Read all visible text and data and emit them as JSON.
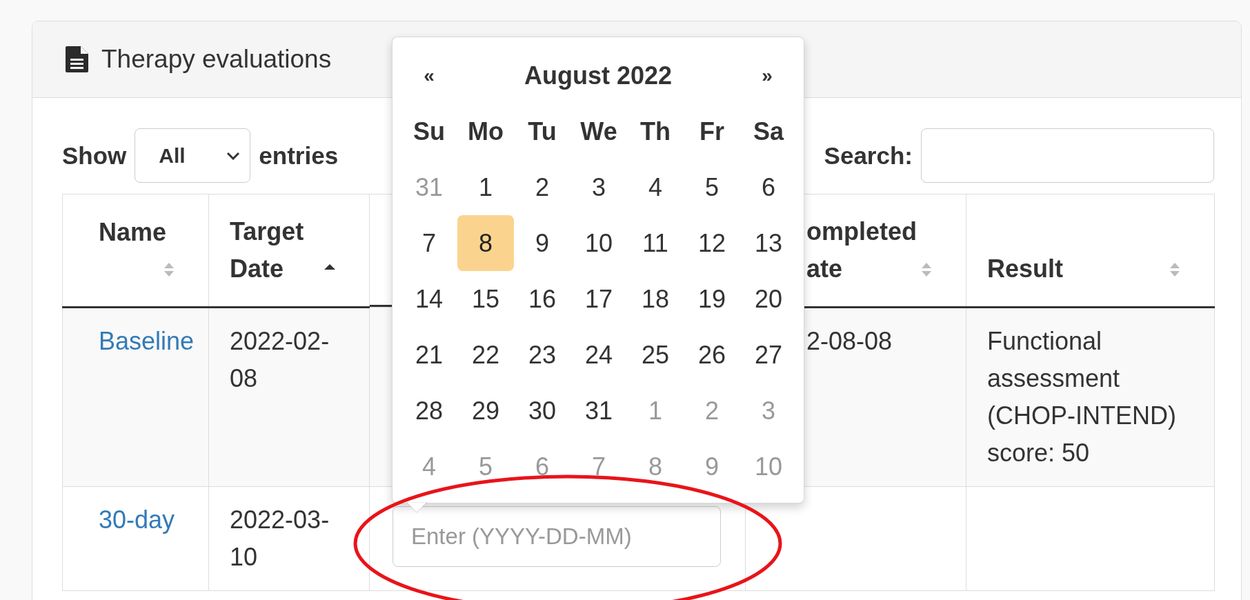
{
  "panel": {
    "title": "Therapy evaluations"
  },
  "length_control": {
    "label_before": "Show",
    "value": "All",
    "label_after": "entries"
  },
  "search": {
    "label": "Search:"
  },
  "table": {
    "columns": [
      {
        "kind": "sortable",
        "label": "Name",
        "sorted_ascending": false
      },
      {
        "kind": "sortable",
        "label": "Target Date",
        "sorted_ascending": true
      },
      {
        "kind": "covered"
      },
      {
        "kind": "sortable",
        "label": "ompleted ate",
        "sorted_ascending": false
      },
      {
        "kind": "sortable",
        "label": "Result",
        "sorted_ascending": false
      }
    ],
    "rows": [
      {
        "cells": [
          {
            "kind": "link",
            "text": "Baseline"
          },
          {
            "kind": "text",
            "text": "2022-02-08"
          },
          {
            "kind": "covered"
          },
          {
            "kind": "text",
            "text": "2-08-08"
          },
          {
            "kind": "text",
            "text": "Functional assessment (CHOP-INTEND) score: 50"
          }
        ]
      },
      {
        "cells": [
          {
            "kind": "link",
            "text": "30-day"
          },
          {
            "kind": "text",
            "text": "2022-03-10"
          },
          {
            "kind": "input",
            "placeholder": "Enter (YYYY-DD-MM)"
          },
          {
            "kind": "empty"
          },
          {
            "kind": "empty"
          }
        ]
      }
    ]
  },
  "datepicker": {
    "prev": "«",
    "title": "August 2022",
    "next": "»",
    "weekdays": [
      "Su",
      "Mo",
      "Tu",
      "We",
      "Th",
      "Fr",
      "Sa"
    ],
    "weeks": [
      [
        {
          "day": "31",
          "other_month": true,
          "selected": false
        },
        {
          "day": "1",
          "other_month": false,
          "selected": false
        },
        {
          "day": "2",
          "other_month": false,
          "selected": false
        },
        {
          "day": "3",
          "other_month": false,
          "selected": false
        },
        {
          "day": "4",
          "other_month": false,
          "selected": false
        },
        {
          "day": "5",
          "other_month": false,
          "selected": false
        },
        {
          "day": "6",
          "other_month": false,
          "selected": false
        }
      ],
      [
        {
          "day": "7",
          "other_month": false,
          "selected": false
        },
        {
          "day": "8",
          "other_month": false,
          "selected": true
        },
        {
          "day": "9",
          "other_month": false,
          "selected": false
        },
        {
          "day": "10",
          "other_month": false,
          "selected": false
        },
        {
          "day": "11",
          "other_month": false,
          "selected": false
        },
        {
          "day": "12",
          "other_month": false,
          "selected": false
        },
        {
          "day": "13",
          "other_month": false,
          "selected": false
        }
      ],
      [
        {
          "day": "14",
          "other_month": false,
          "selected": false
        },
        {
          "day": "15",
          "other_month": false,
          "selected": false
        },
        {
          "day": "16",
          "other_month": false,
          "selected": false
        },
        {
          "day": "17",
          "other_month": false,
          "selected": false
        },
        {
          "day": "18",
          "other_month": false,
          "selected": false
        },
        {
          "day": "19",
          "other_month": false,
          "selected": false
        },
        {
          "day": "20",
          "other_month": false,
          "selected": false
        }
      ],
      [
        {
          "day": "21",
          "other_month": false,
          "selected": false
        },
        {
          "day": "22",
          "other_month": false,
          "selected": false
        },
        {
          "day": "23",
          "other_month": false,
          "selected": false
        },
        {
          "day": "24",
          "other_month": false,
          "selected": false
        },
        {
          "day": "25",
          "other_month": false,
          "selected": false
        },
        {
          "day": "26",
          "other_month": false,
          "selected": false
        },
        {
          "day": "27",
          "other_month": false,
          "selected": false
        }
      ],
      [
        {
          "day": "28",
          "other_month": false,
          "selected": false
        },
        {
          "day": "29",
          "other_month": false,
          "selected": false
        },
        {
          "day": "30",
          "other_month": false,
          "selected": false
        },
        {
          "day": "31",
          "other_month": false,
          "selected": false
        },
        {
          "day": "1",
          "other_month": true,
          "selected": false
        },
        {
          "day": "2",
          "other_month": true,
          "selected": false
        },
        {
          "day": "3",
          "other_month": true,
          "selected": false
        }
      ],
      [
        {
          "day": "4",
          "other_month": true,
          "selected": false
        },
        {
          "day": "5",
          "other_month": true,
          "selected": false
        },
        {
          "day": "6",
          "other_month": true,
          "selected": false
        },
        {
          "day": "7",
          "other_month": true,
          "selected": false
        },
        {
          "day": "8",
          "other_month": true,
          "selected": false
        },
        {
          "day": "9",
          "other_month": true,
          "selected": false
        },
        {
          "day": "10",
          "other_month": true,
          "selected": false
        }
      ]
    ]
  }
}
